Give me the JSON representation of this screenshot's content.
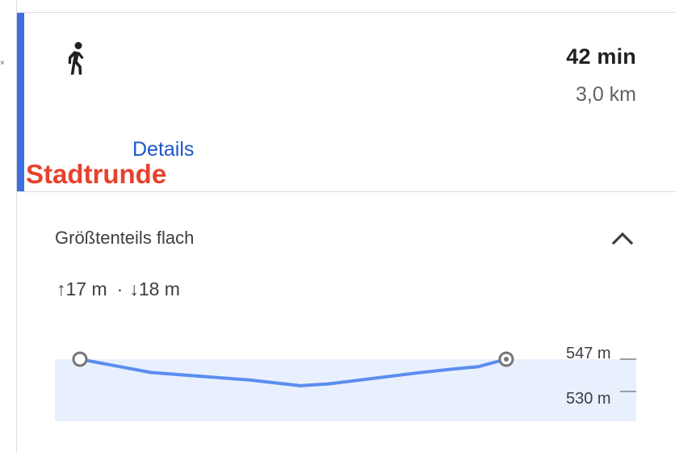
{
  "route": {
    "mode_icon": "walking-person-icon",
    "duration": "42 min",
    "distance": "3,0 km",
    "details_label": "Details",
    "name": "Stadtrunde",
    "accent_color": "#3e6fe0",
    "name_color": "#e8412c",
    "link_color": "#1a57c9"
  },
  "elevation": {
    "title": "Größtenteils flach",
    "ascent": "↑17 m",
    "separator": "·",
    "descent": "↓18 m",
    "collapse_icon": "chevron-up-icon",
    "tick_high": "547 m",
    "tick_low": "530 m",
    "line_color": "#5b8def",
    "fill_color": "#e8f0fe",
    "profile": [
      {
        "km": 0.0,
        "m": 547
      },
      {
        "km": 0.5,
        "m": 540
      },
      {
        "km": 1.2,
        "m": 536
      },
      {
        "km": 1.55,
        "m": 533
      },
      {
        "km": 1.75,
        "m": 534
      },
      {
        "km": 2.4,
        "m": 540
      },
      {
        "km": 2.65,
        "m": 542
      },
      {
        "km": 2.8,
        "m": 543
      },
      {
        "km": 3.0,
        "m": 547
      }
    ]
  }
}
